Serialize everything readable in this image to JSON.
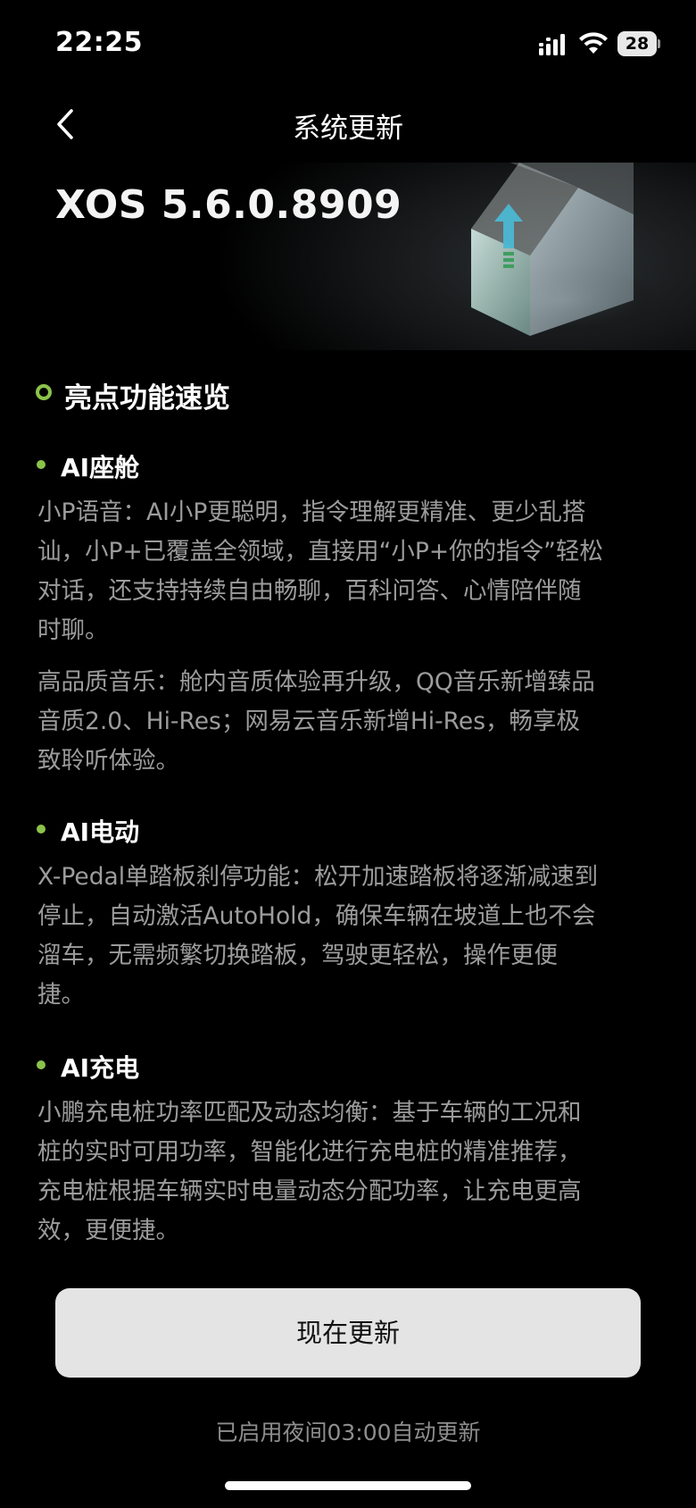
{
  "status_bar": {
    "time": "22:25",
    "battery_level": "28",
    "icons": [
      "cellular-signal-icon",
      "wifi-icon",
      "battery-icon"
    ]
  },
  "nav": {
    "back_icon": "chevron-left-icon",
    "title": "系统更新"
  },
  "hero": {
    "version": "XOS 5.6.0.8909",
    "illustration": "update-cube-icon"
  },
  "colors": {
    "accent": "#8bc34a",
    "background": "#000000",
    "body_text": "#9c9c9c",
    "button_bg": "#e4e4e4"
  },
  "highlights": {
    "title": "亮点功能速览",
    "sections": [
      {
        "title": "AI座舱",
        "paragraphs": [
          [
            "小P语音：AI小P更聪明，指令理解更精准、更少乱搭",
            "讪，小P+已覆盖全领域，直接用“小P+你的指令”轻松",
            "对话，还支持持续自由畅聊，百科问答、心情陪伴随",
            "时聊。"
          ],
          [
            "高品质音乐：舱内音质体验再升级，QQ音乐新增臻品",
            "音质2.0、Hi-Res；网易云音乐新增Hi-Res，畅享极",
            "致聆听体验。"
          ]
        ]
      },
      {
        "title": "AI电动",
        "paragraphs": [
          [
            "X-Pedal单踏板刹停功能：松开加速踏板将逐渐减速到",
            "停止，自动激活AutoHold，确保车辆在坡道上也不会",
            "溜车，无需频繁切换踏板，驾驶更轻松，操作更便",
            "捷。"
          ]
        ]
      },
      {
        "title": "AI充电",
        "paragraphs": [
          [
            "小鹏充电桩功率匹配及动态均衡：基于车辆的工况和",
            "桩的实时可用功率，智能化进行充电桩的精准推荐，",
            "充电桩根据车辆实时电量动态分配功率，让充电更高",
            "效，更便捷。"
          ]
        ]
      }
    ]
  },
  "actions": {
    "update_now": "现在更新",
    "auto_update_note": "已启用夜间03:00自动更新"
  }
}
